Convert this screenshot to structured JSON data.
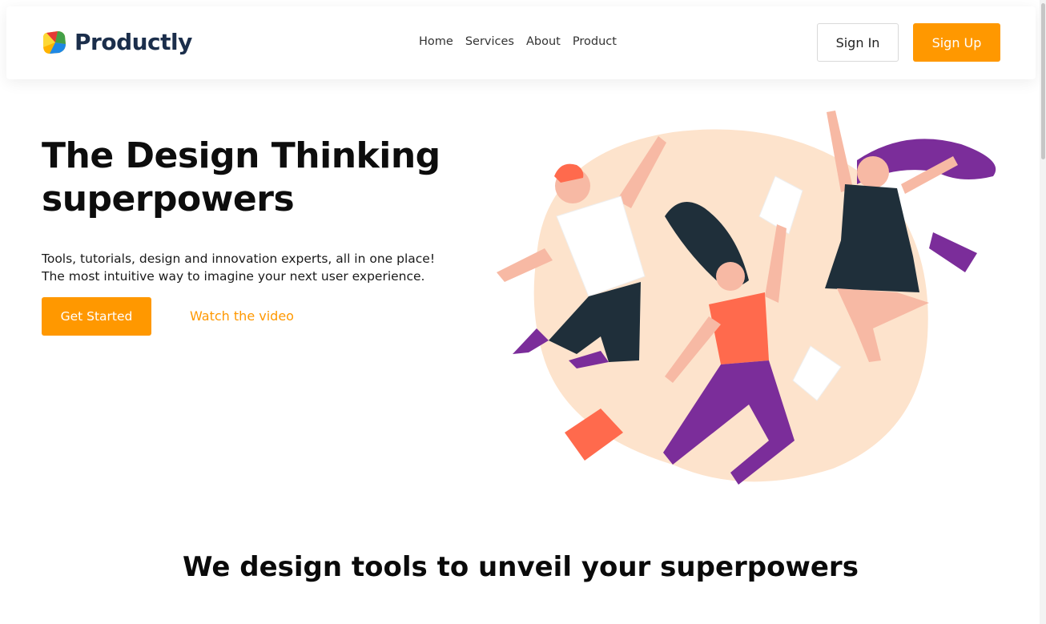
{
  "brand": {
    "name": "Productly",
    "logo_icon": "productly-logo-icon"
  },
  "nav": {
    "links": [
      {
        "label": "Home"
      },
      {
        "label": "Services"
      },
      {
        "label": "About"
      },
      {
        "label": "Product"
      }
    ],
    "signin_label": "Sign In",
    "signup_label": "Sign Up"
  },
  "hero": {
    "title_line1": "The Design Thinking",
    "title_line2": "superpowers",
    "description": "Tools, tutorials, design and innovation experts, all in one place! The most intuitive way to imagine your next user experience.",
    "cta_label": "Get Started",
    "video_label": "Watch the video",
    "illustration_icon": "jumping-people-illustration"
  },
  "section": {
    "title": "We design tools to unveil your superpowers"
  },
  "colors": {
    "accent": "#ff9800",
    "brand_dark": "#1b2e4b",
    "blob": "#fde3cc",
    "purple": "#7b2d9a",
    "coral": "#ff6a4d",
    "dark": "#1f2f3a"
  }
}
